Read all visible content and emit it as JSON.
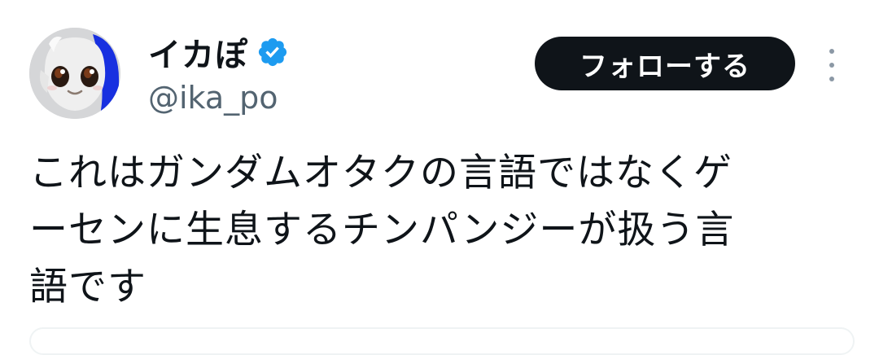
{
  "user": {
    "display_name": "イカぽ",
    "handle": "@ika_po",
    "verified": true,
    "verified_color": "#1d9bf0",
    "avatar_icon": "avatar-character-icon"
  },
  "actions": {
    "follow_label": "フォローする",
    "more_icon": "more-vertical-icon"
  },
  "tweet": {
    "lines": [
      "これはガンダムオタクの言語ではなくゲ",
      "ーセンに生息するチンパンジーが扱う言",
      "語です"
    ]
  },
  "colors": {
    "text": "#0f1419",
    "secondary_text": "#536471",
    "button_bg": "#0f1419",
    "button_text": "#ffffff"
  }
}
